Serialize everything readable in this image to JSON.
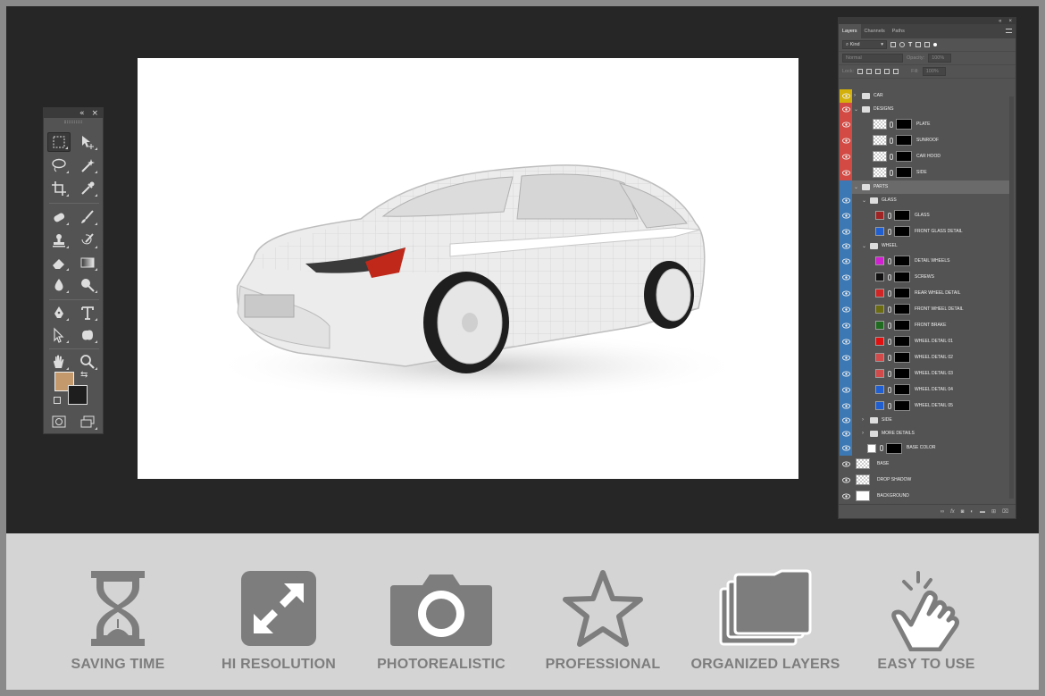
{
  "toolbox": {
    "collapse_glyph": "«",
    "close_glyph": "×",
    "tools": [
      {
        "name": "rectangular-marquee-tool",
        "icon": "marquee-icon"
      },
      {
        "name": "move-tool",
        "icon": "move-icon"
      },
      {
        "name": "lasso-tool",
        "icon": "lasso-icon"
      },
      {
        "name": "magic-wand-tool",
        "icon": "magic-wand-icon"
      },
      {
        "name": "crop-tool",
        "icon": "crop-icon"
      },
      {
        "name": "eyedropper-tool",
        "icon": "eyedropper-icon"
      },
      {
        "name": "healing-brush-tool",
        "icon": "bandage-icon"
      },
      {
        "name": "brush-tool",
        "icon": "brush-icon"
      },
      {
        "name": "clone-stamp-tool",
        "icon": "stamp-icon"
      },
      {
        "name": "history-brush-tool",
        "icon": "history-brush-icon"
      },
      {
        "name": "eraser-tool",
        "icon": "eraser-icon"
      },
      {
        "name": "gradient-tool",
        "icon": "gradient-icon"
      },
      {
        "name": "blur-tool",
        "icon": "drop-icon"
      },
      {
        "name": "dodge-tool",
        "icon": "magnifier-icon"
      },
      {
        "name": "pen-tool",
        "icon": "pen-icon"
      },
      {
        "name": "type-tool",
        "icon": "type-icon"
      },
      {
        "name": "path-selection-tool",
        "icon": "arrow-icon"
      },
      {
        "name": "custom-shape-tool",
        "icon": "shape-icon"
      },
      {
        "name": "hand-tool",
        "icon": "hand-icon"
      },
      {
        "name": "zoom-tool",
        "icon": "zoom-icon"
      }
    ],
    "foreground_color": "#c49a6c",
    "background_color": "#1e1e1e"
  },
  "layers_panel": {
    "tabs": [
      "Layers",
      "Channels",
      "Paths"
    ],
    "kind_label": "Kind",
    "blend_mode": "Normal",
    "opacity_label": "Opacity:",
    "opacity_value": "100%",
    "lock_label": "Lock:",
    "fill_label": "Fill:",
    "fill_value": "100%",
    "layers": [
      {
        "name": "CAR",
        "kind": "group",
        "indent": 0,
        "tag": "#d4b00a",
        "open": false
      },
      {
        "name": "DESIGNS",
        "kind": "group",
        "indent": 0,
        "tag": "#d24a43",
        "open": true
      },
      {
        "name": "PLATE",
        "kind": "smart",
        "indent": 1,
        "tag": "#d24a43"
      },
      {
        "name": "SUNROOF",
        "kind": "smart",
        "indent": 1,
        "tag": "#d24a43"
      },
      {
        "name": "CAR HOOD",
        "kind": "smart",
        "indent": 1,
        "tag": "#d24a43"
      },
      {
        "name": "SIDE",
        "kind": "smart",
        "indent": 1,
        "tag": "#d24a43"
      },
      {
        "name": "PARTS",
        "kind": "group",
        "indent": 0,
        "tag": "#3c78b4",
        "open": true,
        "selected": true
      },
      {
        "name": "GLASS",
        "kind": "group",
        "indent": 1,
        "tag": "#3c78b4",
        "open": true
      },
      {
        "name": "GLASS",
        "kind": "fill",
        "indent": 2,
        "tag": "#3c78b4",
        "swatch": "#a02424"
      },
      {
        "name": "FRONT GLASS DETAIL",
        "kind": "fill",
        "indent": 2,
        "tag": "#3c78b4",
        "swatch": "#1f5fd1"
      },
      {
        "name": "WHEEL",
        "kind": "group",
        "indent": 1,
        "tag": "#3c78b4",
        "open": true
      },
      {
        "name": "DETAIL WHEELS",
        "kind": "fill",
        "indent": 2,
        "tag": "#3c78b4",
        "swatch": "#d11fd1"
      },
      {
        "name": "SCREWS",
        "kind": "fill",
        "indent": 2,
        "tag": "#3c78b4",
        "swatch": "#111111"
      },
      {
        "name": "REAR WHEEL DETAIL",
        "kind": "fill",
        "indent": 2,
        "tag": "#3c78b4",
        "swatch": "#d12424"
      },
      {
        "name": "FRONT WHEEL DETAIL",
        "kind": "fill",
        "indent": 2,
        "tag": "#3c78b4",
        "swatch": "#6b6b12"
      },
      {
        "name": "FRONT BRAKE",
        "kind": "fill",
        "indent": 2,
        "tag": "#3c78b4",
        "swatch": "#1f6b1f"
      },
      {
        "name": "WHEEL DETAIL 01",
        "kind": "fill",
        "indent": 2,
        "tag": "#3c78b4",
        "swatch": "#e01010"
      },
      {
        "name": "WHEEL DETAIL 02",
        "kind": "fill",
        "indent": 2,
        "tag": "#3c78b4",
        "swatch": "#d24a4a"
      },
      {
        "name": "WHEEL DETAIL 03",
        "kind": "fill",
        "indent": 2,
        "tag": "#3c78b4",
        "swatch": "#d24a4a"
      },
      {
        "name": "WHEEL DETAIL 04",
        "kind": "fill",
        "indent": 2,
        "tag": "#3c78b4",
        "swatch": "#1f5fd1"
      },
      {
        "name": "WHEEL DETAIL 05",
        "kind": "fill",
        "indent": 2,
        "tag": "#3c78b4",
        "swatch": "#1f5fd1"
      },
      {
        "name": "SIDE",
        "kind": "group",
        "indent": 1,
        "tag": "#3c78b4",
        "open": false
      },
      {
        "name": "MORE DETAILS",
        "kind": "group",
        "indent": 1,
        "tag": "#3c78b4",
        "open": false
      },
      {
        "name": "BASE COLOR",
        "kind": "fill",
        "indent": 1,
        "tag": "#3c78b4",
        "swatch": "#ffffff"
      },
      {
        "name": "BASE",
        "kind": "pixel",
        "indent": 0,
        "tag": ""
      },
      {
        "name": "DROP SHADOW",
        "kind": "pixel",
        "indent": 0,
        "tag": ""
      },
      {
        "name": "BACKGROUND",
        "kind": "plain",
        "indent": 0,
        "tag": ""
      }
    ],
    "footer_icons": [
      "link-icon",
      "fx-icon",
      "mask-icon",
      "adjustment-icon",
      "group-icon",
      "new-layer-icon",
      "trash-icon"
    ]
  },
  "features": [
    {
      "label": "SAVING TIME",
      "icon": "hourglass-icon"
    },
    {
      "label": "HI RESOLUTION",
      "icon": "expand-icon"
    },
    {
      "label": "PHOTOREALISTIC",
      "icon": "camera-icon"
    },
    {
      "label": "PROFESSIONAL",
      "icon": "star-icon"
    },
    {
      "label": "ORGANIZED LAYERS",
      "icon": "folders-icon"
    },
    {
      "label": "EASY TO USE",
      "icon": "hand-pointer-icon"
    }
  ],
  "colors": {
    "workspace": "#262626",
    "panel": "#535353",
    "feature_icon": "#7d7d7d",
    "feature_bg": "#d4d4d4"
  }
}
